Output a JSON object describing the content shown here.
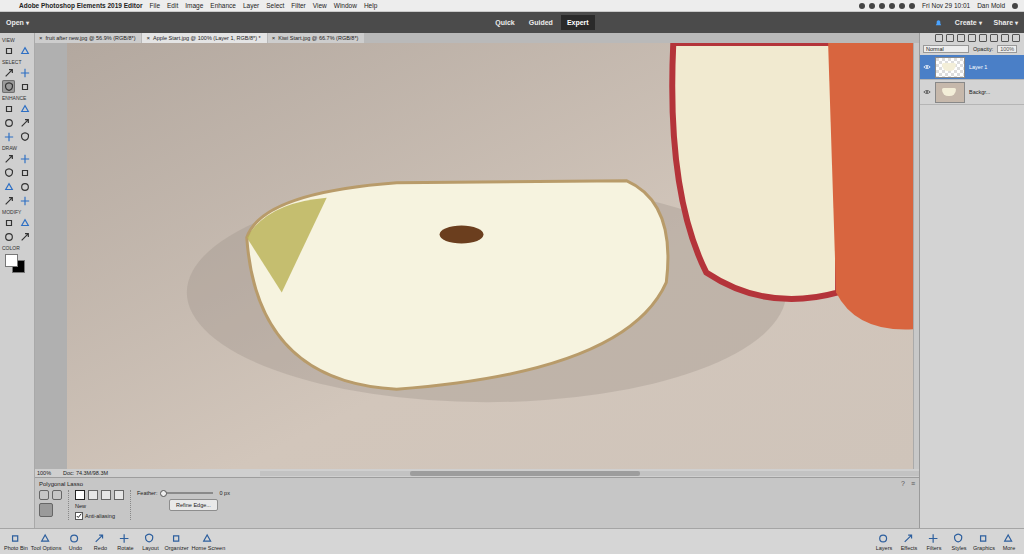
{
  "menubar": {
    "apple": "",
    "app": "Adobe Photoshop Elements 2019 Editor",
    "menus": [
      "File",
      "Edit",
      "Image",
      "Enhance",
      "Layer",
      "Select",
      "Filter",
      "View",
      "Window",
      "Help"
    ],
    "clock": "Fri Nov 29  10:01",
    "user": "Dan Mold"
  },
  "appbar": {
    "open": "Open",
    "open_arrow": "▾",
    "modes": [
      {
        "label": "Quick",
        "selected": false
      },
      {
        "label": "Guided",
        "selected": false
      },
      {
        "label": "Expert",
        "selected": true
      }
    ],
    "create": "Create",
    "share": "Share",
    "arrow": "▾"
  },
  "doc_tabs": [
    {
      "label": "fruit after new.jpg @ 56.9% (RGB/8*)",
      "close": "×",
      "selected": false
    },
    {
      "label": "Apple Start.jpg @ 100% (Layer 1, RGB/8*) *",
      "close": "×",
      "selected": true
    },
    {
      "label": "Kiwi Start.jpg @ 66.7% (RGB/8*)",
      "close": "×",
      "selected": false
    }
  ],
  "toolbar": {
    "sections": [
      {
        "label": "VIEW",
        "tools": [
          {
            "selected": false
          },
          {
            "selected": false
          }
        ]
      },
      {
        "label": "SELECT",
        "tools": [
          {
            "selected": false
          },
          {
            "selected": false
          },
          {
            "selected": true
          },
          {
            "selected": false
          }
        ]
      },
      {
        "label": "ENHANCE",
        "tools": [
          {
            "selected": false
          },
          {
            "selected": false
          },
          {
            "selected": false
          },
          {
            "selected": false
          },
          {
            "selected": false
          },
          {
            "selected": false
          }
        ]
      },
      {
        "label": "DRAW",
        "tools": [
          {
            "selected": false
          },
          {
            "selected": false
          },
          {
            "selected": false
          },
          {
            "selected": false
          },
          {
            "selected": false
          },
          {
            "selected": false
          },
          {
            "selected": false
          },
          {
            "selected": false
          }
        ]
      },
      {
        "label": "MODIFY",
        "tools": [
          {
            "selected": false
          },
          {
            "selected": false
          },
          {
            "selected": false
          },
          {
            "selected": false
          }
        ]
      },
      {
        "label": "COLOR",
        "tools": []
      }
    ]
  },
  "canvas": {
    "zoom": "100%",
    "doc": "Doc: 74.3M/98.3M"
  },
  "tool_options": {
    "name": "Polygonal Lasso",
    "mode": "New",
    "anti_aliasing": {
      "label": "Anti-aliasing",
      "checked": true
    },
    "feather_label": "Feather:",
    "feather_level": 0,
    "feather_value": "0 px",
    "refine": "Refine Edge...",
    "help": "?",
    "menu": "≡"
  },
  "layers_panel": {
    "blend": "Normal",
    "opacity_label": "Opacity:",
    "opacity": "100%",
    "layers": [
      {
        "name": "Layer 1",
        "selected": true,
        "visible": true
      },
      {
        "name": "Backgr...",
        "selected": false,
        "visible": true
      }
    ]
  },
  "bottom_left": [
    "Photo Bin",
    "Tool Options",
    "Undo",
    "Redo",
    "Rotate",
    "Layout",
    "Organizer",
    "Home Screen"
  ],
  "bottom_right": [
    "Layers",
    "Effects",
    "Filters",
    "Styles",
    "Graphics",
    "More"
  ]
}
